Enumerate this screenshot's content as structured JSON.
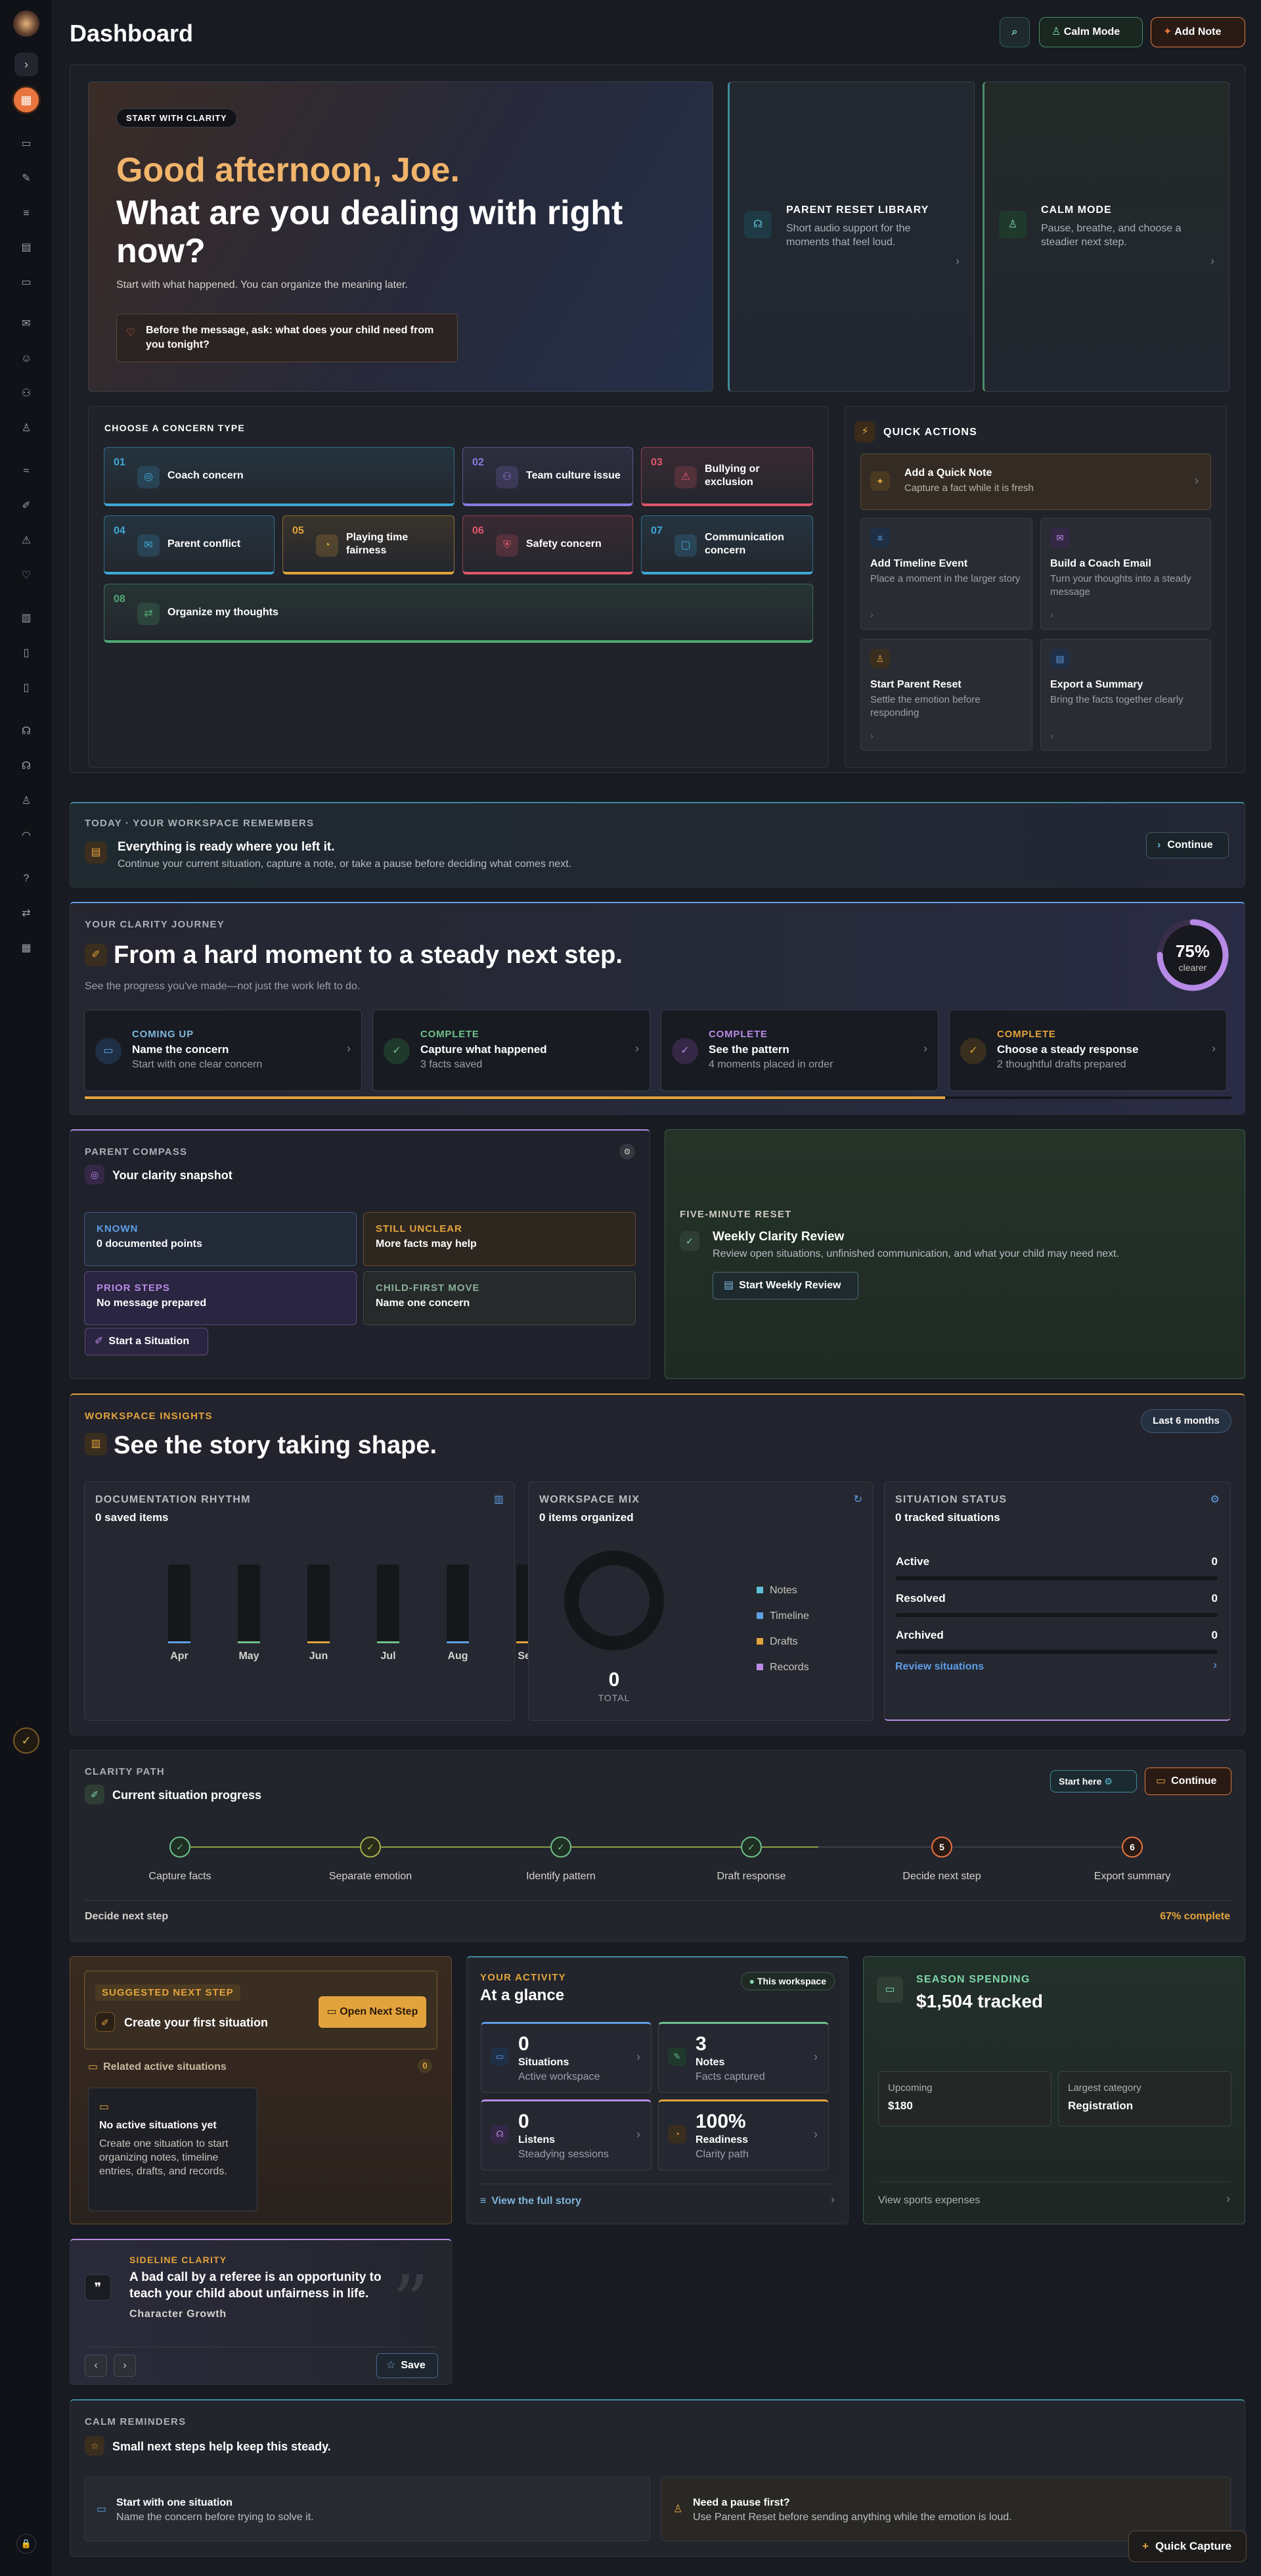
{
  "page": {
    "title": "Dashboard"
  },
  "toolbar": {
    "calm_label": "Calm Mode",
    "add_label": "Add Note"
  },
  "hero": {
    "badge": "START WITH CLARITY",
    "greeting": "Good afternoon, Joe.",
    "question": "What are you dealing with right now?",
    "subtitle": "Start with what happened. You can organize the meaning later.",
    "prompt": "Before the message, ask: what does your child need from you tonight?"
  },
  "side_cards": [
    {
      "title": "PARENT RESET LIBRARY",
      "desc": "Short audio support for the moments that feel loud."
    },
    {
      "title": "CALM MODE",
      "desc": "Pause, breathe, and choose a steadier next step."
    }
  ],
  "concerns": {
    "title": "CHOOSE A CONCERN TYPE",
    "items": [
      {
        "num": "01",
        "label": "Coach concern",
        "color": "#3fa7d6"
      },
      {
        "num": "02",
        "label": "Team culture issue",
        "color": "#8b7ae0"
      },
      {
        "num": "03",
        "label": "Bullying or exclusion",
        "color": "#e0566b"
      },
      {
        "num": "04",
        "label": "Parent conflict",
        "color": "#3fa7d6"
      },
      {
        "num": "05",
        "label": "Playing time fairness",
        "color": "#e3a33c"
      },
      {
        "num": "06",
        "label": "Safety concern",
        "color": "#e0566b"
      },
      {
        "num": "07",
        "label": "Communication concern",
        "color": "#3fa7d6"
      },
      {
        "num": "08",
        "label": "Organize my thoughts",
        "color": "#4fa874"
      }
    ]
  },
  "quick_actions": {
    "title": "QUICK ACTIONS",
    "items": [
      {
        "title": "Add a Quick Note",
        "desc": "Capture a fact while it is fresh"
      },
      {
        "title": "Add Timeline Event",
        "desc": "Place a moment in the larger story"
      },
      {
        "title": "Build a Coach Email",
        "desc": "Turn your thoughts into a steady message"
      },
      {
        "title": "Start Parent Reset",
        "desc": "Settle the emotion before responding"
      },
      {
        "title": "Export a Summary",
        "desc": "Bring the facts together clearly"
      }
    ]
  },
  "today": {
    "label": "TODAY · YOUR WORKSPACE REMEMBERS",
    "title": "Everything is ready where you left it.",
    "desc": "Continue your current situation, capture a note, or take a pause before deciding what comes next.",
    "button": "Continue"
  },
  "journey": {
    "label": "YOUR CLARITY JOURNEY",
    "title": "From a hard moment to a steady next step.",
    "subtitle": "See the progress you've made—not just the work left to do.",
    "percent": "75%",
    "percent_value": 75,
    "percent_label": "clearer",
    "progress": 0.75,
    "steps": [
      {
        "status": "COMING UP",
        "title": "Name the concern",
        "desc": "Start with one clear concern",
        "color": "#7fb6dc"
      },
      {
        "status": "COMPLETE",
        "title": "Capture what happened",
        "desc": "3 facts saved",
        "color": "#6fc08a"
      },
      {
        "status": "COMPLETE",
        "title": "See the pattern",
        "desc": "4 moments placed in order",
        "color": "#b78ae6"
      },
      {
        "status": "COMPLETE",
        "title": "Choose a steady response",
        "desc": "2 thoughtful drafts prepared",
        "color": "#e3a33c"
      }
    ]
  },
  "compass": {
    "label": "PARENT COMPASS",
    "title": "Your clarity snapshot",
    "items": [
      {
        "key": "KNOWN",
        "value": "0 documented points"
      },
      {
        "key": "STILL UNCLEAR",
        "value": "More facts may help"
      },
      {
        "key": "PRIOR STEPS",
        "value": "No message prepared"
      },
      {
        "key": "CHILD-FIRST MOVE",
        "value": "Name one concern"
      }
    ],
    "button": "Start a Situation"
  },
  "reset": {
    "label": "FIVE-MINUTE RESET",
    "title": "Weekly Clarity Review",
    "desc": "Review open situations, unfinished communication, and what your child may need next.",
    "button": "Start Weekly Review"
  },
  "insights": {
    "label": "WORKSPACE INSIGHTS",
    "title": "See the story taking shape.",
    "range": "Last 6 months"
  },
  "rhythm": {
    "label": "DOCUMENTATION RHYTHM",
    "count": "0 saved items"
  },
  "chart_data": {
    "type": "bar",
    "categories": [
      "Apr",
      "May",
      "Jun",
      "Jul",
      "Aug",
      "Sep"
    ],
    "values": [
      0,
      0,
      0,
      0,
      0,
      0
    ]
  },
  "mix": {
    "label": "WORKSPACE MIX",
    "count": "0 items organized",
    "total": "0",
    "total_label": "TOTAL",
    "legend": [
      {
        "name": "Notes",
        "value": "0",
        "color": "#5fc1d6"
      },
      {
        "name": "Timeline",
        "value": "0",
        "color": "#5f9ee6"
      },
      {
        "name": "Drafts",
        "value": "0",
        "color": "#e3a33c"
      },
      {
        "name": "Records",
        "value": "0",
        "color": "#b78ae6"
      }
    ]
  },
  "status": {
    "label": "SITUATION STATUS",
    "count": "0 tracked situations",
    "items": [
      {
        "name": "Active",
        "value": "0"
      },
      {
        "name": "Resolved",
        "value": "0"
      },
      {
        "name": "Archived",
        "value": "0"
      }
    ],
    "link": "Review situations"
  },
  "path": {
    "label": "CLARITY PATH",
    "title": "Current situation progress",
    "start_here": "Start here",
    "continue": "Continue",
    "steps": [
      "Capture facts",
      "Separate emotion",
      "Identify pattern",
      "Draft response",
      "Decide next step",
      "Export summary"
    ],
    "step_five": "5",
    "step_six": "6",
    "current": "Decide next step",
    "complete": "67% complete",
    "progress": 0.67
  },
  "suggest": {
    "badge": "SUGGESTED NEXT STEP",
    "title": "Create your first situation",
    "button": "Open Next Step",
    "related": "Related active situations",
    "related_count": "0",
    "empty_title": "No active situations yet",
    "empty_desc": "Create one situation to start organizing notes, timeline entries, drafts, and records."
  },
  "activity": {
    "label": "YOUR ACTIVITY",
    "title": "At a glance",
    "badge": "This workspace",
    "items": [
      {
        "num": "0",
        "title": "Situations",
        "desc": "Active workspace"
      },
      {
        "num": "3",
        "title": "Notes",
        "desc": "Facts captured"
      },
      {
        "num": "0",
        "title": "Listens",
        "desc": "Steadying sessions"
      },
      {
        "num": "100%",
        "title": "Readiness",
        "desc": "Clarity path"
      }
    ],
    "link": "View the full story"
  },
  "spending": {
    "label": "SEASON SPENDING",
    "amount": "$1,504 tracked",
    "upcoming_label": "Upcoming",
    "upcoming": "$180",
    "largest_label": "Largest category",
    "largest": "Registration",
    "link": "View sports expenses"
  },
  "sideline": {
    "label": "SIDELINE CLARITY",
    "quote": "A bad call by a referee is an opportunity to teach your child about unfairness in life.",
    "tag": "Character Growth",
    "save": "Save"
  },
  "reminders": {
    "label": "CALM REMINDERS",
    "title": "Small next steps help keep this steady.",
    "items": [
      {
        "title": "Start with one situation",
        "desc": "Name the concern before trying to solve it."
      },
      {
        "title": "Need a pause first?",
        "desc": "Use Parent Reset before sending anything while the emotion is loud."
      }
    ]
  },
  "quick_capture": "Quick Capture"
}
